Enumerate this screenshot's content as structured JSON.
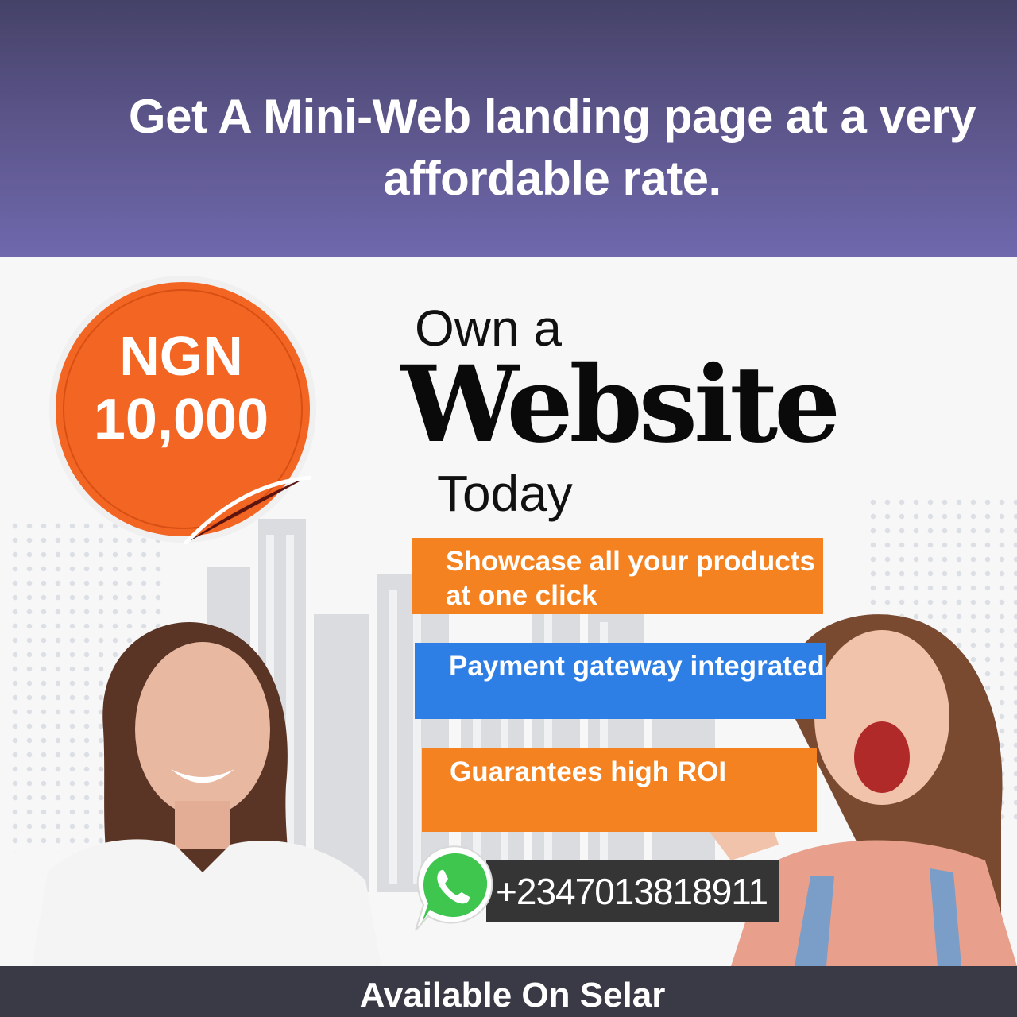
{
  "header": {
    "headline": "Get A Mini-Web landing page at a very affordable rate."
  },
  "price_badge": {
    "currency": "NGN",
    "amount": "10,000"
  },
  "hero": {
    "line1": "Own a",
    "line2": "Website",
    "line3": "Today"
  },
  "features": [
    {
      "text": "Showcase all your products at one click",
      "color": "#f58220"
    },
    {
      "text": "Payment gateway integrated",
      "color": "#2d7fe6"
    },
    {
      "text": "Guarantees high ROI",
      "color": "#f58220"
    }
  ],
  "contact": {
    "icon": "whatsapp-icon",
    "phone": "+2347013818911"
  },
  "footer": {
    "text": "Available On Selar"
  },
  "colors": {
    "banner": "#5a5488",
    "orange": "#f58220",
    "blue": "#2d7fe6",
    "badge": "#f26522"
  }
}
